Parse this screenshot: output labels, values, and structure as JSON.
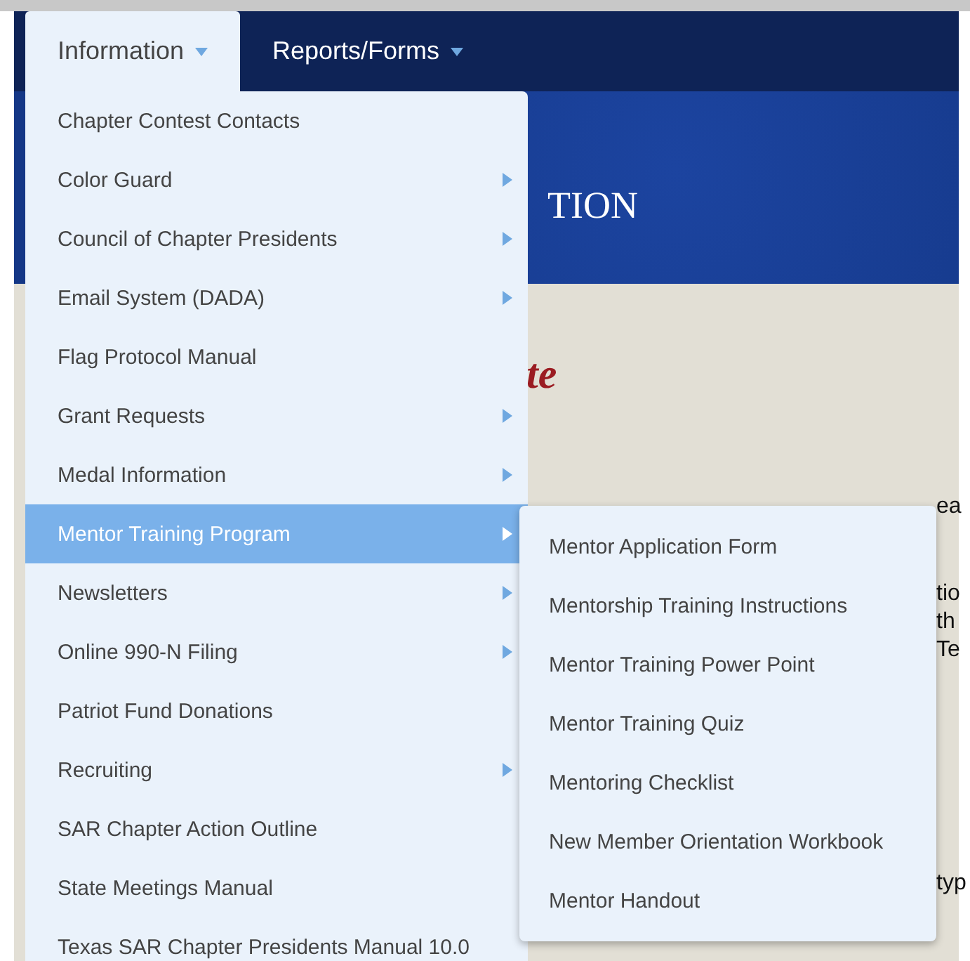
{
  "nav": {
    "tabs": [
      {
        "label": "Information",
        "selected": true
      },
      {
        "label": "Reports/Forms",
        "selected": false
      }
    ]
  },
  "header": {
    "title_fragment": "TION"
  },
  "content": {
    "heading_fragment": "te",
    "text_fragments": [
      "ea",
      "tio",
      "th",
      "Te",
      "typ"
    ]
  },
  "menu": {
    "items": [
      {
        "label": "Chapter Contest Contacts",
        "has_submenu": false,
        "selected": false
      },
      {
        "label": "Color Guard",
        "has_submenu": true,
        "selected": false
      },
      {
        "label": "Council of Chapter Presidents",
        "has_submenu": true,
        "selected": false
      },
      {
        "label": "Email System (DADA)",
        "has_submenu": true,
        "selected": false
      },
      {
        "label": "Flag Protocol Manual",
        "has_submenu": false,
        "selected": false
      },
      {
        "label": "Grant Requests",
        "has_submenu": true,
        "selected": false
      },
      {
        "label": "Medal Information",
        "has_submenu": true,
        "selected": false
      },
      {
        "label": "Mentor Training Program",
        "has_submenu": true,
        "selected": true
      },
      {
        "label": "Newsletters",
        "has_submenu": true,
        "selected": false
      },
      {
        "label": "Online 990-N Filing",
        "has_submenu": true,
        "selected": false
      },
      {
        "label": "Patriot Fund Donations",
        "has_submenu": false,
        "selected": false
      },
      {
        "label": "Recruiting",
        "has_submenu": true,
        "selected": false
      },
      {
        "label": "SAR Chapter Action Outline",
        "has_submenu": false,
        "selected": false
      },
      {
        "label": "State Meetings Manual",
        "has_submenu": false,
        "selected": false
      },
      {
        "label": "Texas SAR Chapter Presidents Manual 10.0",
        "has_submenu": false,
        "selected": false
      }
    ]
  },
  "submenu": {
    "items": [
      "Mentor Application Form",
      "Mentorship Training Instructions",
      "Mentor Training Power Point",
      "Mentor Training Quiz",
      "Mentoring Checklist",
      "New Member Orientation Workbook",
      "Mentor Handout"
    ]
  }
}
